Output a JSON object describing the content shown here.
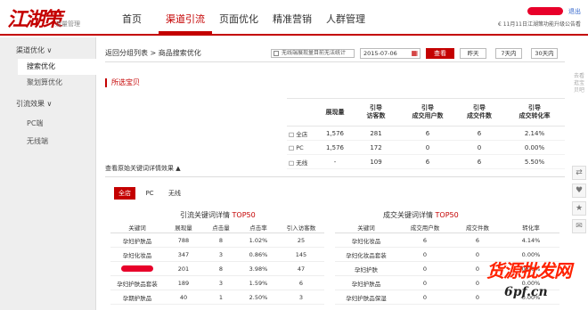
{
  "header": {
    "logo_text": "江湖策",
    "logo_sub": "流量管理",
    "nav": [
      "首页",
      "渠道引流",
      "页面优化",
      "精准营销",
      "人群管理"
    ],
    "active_nav": 1,
    "logout": "退出",
    "notice": "€ 11月11日江湖策功能升级公告看"
  },
  "sidebar": {
    "group1": "渠道优化 ∨",
    "group1_items": [
      "搜索优化",
      "聚划算优化"
    ],
    "group2": "引流效果 ∨",
    "group2_items": [
      "PC端",
      "无线端"
    ]
  },
  "toolbar": {
    "breadcrumb": "返回分组列表 > 商品搜索优化",
    "checkbox_label": "无线端展现量目前无法统计",
    "date": "2015-07-06",
    "search_label": "查看",
    "ranges": [
      "昨天",
      "7天内",
      "30天内"
    ]
  },
  "section_title": "所选宝贝",
  "summary": {
    "headers": [
      "",
      "展现量",
      "引导\n访客数",
      "引导\n成交用户数",
      "引导\n成交件数",
      "引导\n成交转化率"
    ],
    "rows": [
      {
        "icon": "□",
        "label": "全店",
        "impressions": "1,576",
        "visitors": "281",
        "buyers": "6",
        "items": "6",
        "cvr": "2.14%"
      },
      {
        "icon": "□",
        "label": "PC",
        "impressions": "1,576",
        "visitors": "172",
        "buyers": "0",
        "items": "0",
        "cvr": "0.00%"
      },
      {
        "icon": "□",
        "label": "无线",
        "impressions": "-",
        "visitors": "109",
        "buyers": "6",
        "items": "6",
        "cvr": "5.50%"
      }
    ]
  },
  "expand_label": "查看原始关键词详情效果 ▲",
  "tabs": [
    "全店",
    "PC",
    "无线"
  ],
  "active_tab": 0,
  "traffic_kw": {
    "title_prefix": "引流关键词详情 ",
    "title_hl": "TOP50",
    "headers": [
      "关键词",
      "展现量",
      "点击量",
      "点击率",
      "引入访客数"
    ],
    "rows": [
      [
        "孕妇护肤品",
        "788",
        "8",
        "1.02%",
        "25"
      ],
      [
        "孕妇化妆品",
        "347",
        "3",
        "0.86%",
        "145"
      ],
      [
        "",
        "201",
        "8",
        "3.98%",
        "47"
      ],
      [
        "孕妇护肤品套装",
        "189",
        "3",
        "1.59%",
        "6"
      ],
      [
        "孕期护肤品",
        "40",
        "1",
        "2.50%",
        "3"
      ]
    ]
  },
  "deal_kw": {
    "title_prefix": "成交关键词详情 ",
    "title_hl": "TOP50",
    "headers": [
      "关键词",
      "成交用户数",
      "成交件数",
      "转化率"
    ],
    "rows": [
      [
        "孕妇化妆品",
        "6",
        "6",
        "4.14%"
      ],
      [
        "孕妇化妆品套装",
        "0",
        "0",
        "0.00%"
      ],
      [
        "孕妇护肤",
        "0",
        "0",
        "0.00%"
      ],
      [
        "孕妇护肤品",
        "0",
        "0",
        "0.00%"
      ],
      [
        "孕妇护肤品保湿",
        "0",
        "0",
        "0.00%"
      ]
    ]
  },
  "float_text": "去看逛宝贝吧",
  "watermark": "货源批发网",
  "watermark_url": "6pf.cn"
}
